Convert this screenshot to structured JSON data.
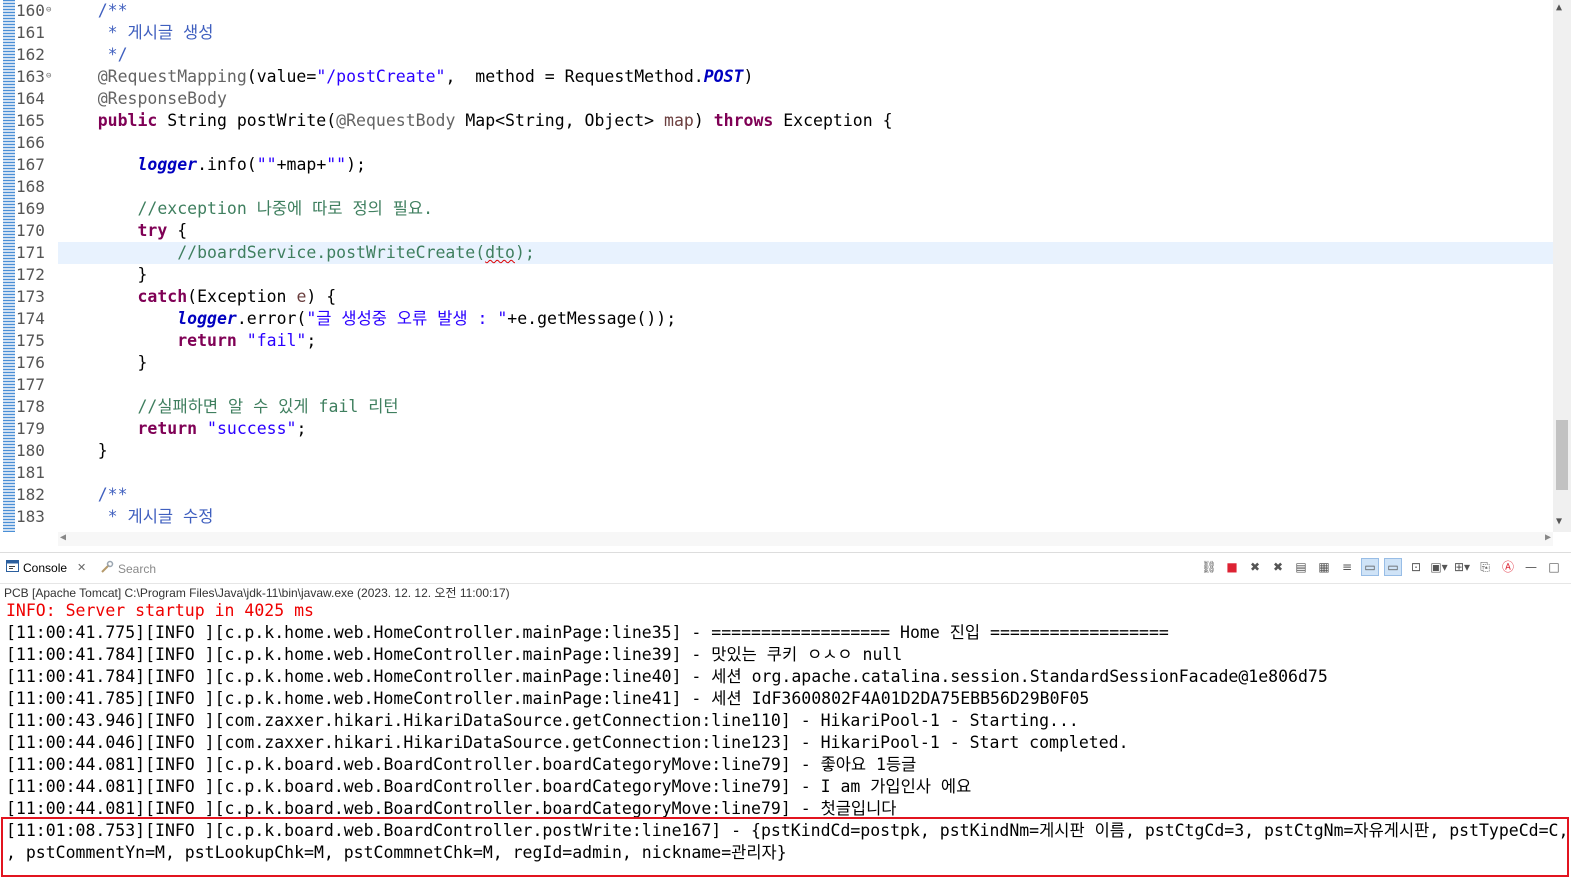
{
  "editor": {
    "line_numbers": [
      "160",
      "161",
      "162",
      "163",
      "164",
      "165",
      "166",
      "167",
      "168",
      "169",
      "170",
      "171",
      "172",
      "173",
      "174",
      "175",
      "176",
      "177",
      "178",
      "179",
      "180",
      "181",
      "182",
      "183"
    ],
    "code": {
      "l160": "/**",
      "l161": " * 게시글 생성",
      "l162": " */",
      "l163_ann": "@RequestMapping",
      "l163_a": "(value=",
      "l163_str": "\"/postCreate\"",
      "l163_b": ",  method = RequestMethod.",
      "l163_const": "POST",
      "l163_c": ")",
      "l164_ann": "@ResponseBody",
      "l165_kw1": "public",
      "l165_a": " String postWrite(",
      "l165_ann": "@RequestBody",
      "l165_b": " Map<String, Object> ",
      "l165_param": "map",
      "l165_c": ") ",
      "l165_kw2": "throws",
      "l165_d": " Exception {",
      "l167_field": "logger",
      "l167_a": ".info(",
      "l167_str1": "\"\"",
      "l167_b": "+map+",
      "l167_str2": "\"\"",
      "l167_c": ");",
      "l169_cmt": "//exception 나중에 따로 정의 필요.",
      "l170_kw": "try",
      "l170_a": " {",
      "l171_cmt_a": "//boardService.postWriteCreate(",
      "l171_cmt_sq": "dto",
      "l171_cmt_b": ");",
      "l172": "}",
      "l173_kw": "catch",
      "l173_a": "(Exception ",
      "l173_param": "e",
      "l173_b": ") {",
      "l174_field": "logger",
      "l174_a": ".error(",
      "l174_str": "\"글 생성중 오류 발생 : \"",
      "l174_b": "+e.getMessage());",
      "l175_kw": "return",
      "l175_str": "\"fail\"",
      "l175_a": ";",
      "l176": "}",
      "l178_cmt": "//실패하면 알 수 있게 fail 리턴",
      "l179_kw": "return",
      "l179_str": "\"success\"",
      "l179_a": ";",
      "l180": "}",
      "l182": "/**",
      "l183": " * 게시글 수정"
    }
  },
  "console": {
    "tab_label": "Console",
    "search_tab_label": "Search",
    "process_description": "PCB [Apache Tomcat] C:\\Program Files\\Java\\jdk-11\\bin\\javaw.exe (2023. 12. 12. 오전 11:00:17)",
    "lines": [
      "INFO: Server startup in 4025 ms",
      "[11:00:41.775][INFO ][c.p.k.home.web.HomeController.mainPage:line35] - ================== Home 진입 ==================",
      "[11:00:41.784][INFO ][c.p.k.home.web.HomeController.mainPage:line39] - 맛있는 쿠키 ㅇㅅㅇ null",
      "[11:00:41.784][INFO ][c.p.k.home.web.HomeController.mainPage:line40] - 세션 org.apache.catalina.session.StandardSessionFacade@1e806d75",
      "[11:00:41.785][INFO ][c.p.k.home.web.HomeController.mainPage:line41] - 세션 IdF3600802F4A01D2DA75EBB56D29B0F05",
      "[11:00:43.946][INFO ][com.zaxxer.hikari.HikariDataSource.getConnection:line110] - HikariPool-1 - Starting...",
      "[11:00:44.046][INFO ][com.zaxxer.hikari.HikariDataSource.getConnection:line123] - HikariPool-1 - Start completed.",
      "[11:00:44.081][INFO ][c.p.k.board.web.BoardController.boardCategoryMove:line79] - 좋아요 1등글",
      "[11:00:44.081][INFO ][c.p.k.board.web.BoardController.boardCategoryMove:line79] - I am 가입인사 에요",
      "[11:00:44.081][INFO ][c.p.k.board.web.BoardController.boardCategoryMove:line79] - 첫글입니다",
      "[11:01:08.753][INFO ][c.p.k.board.web.BoardController.postWrite:line167] - {pstKindCd=postpk, pstKindNm=게시판 이름, pstCtgCd=3, pstCtgNm=자유게시판, pstTypeCd=C,",
      ", pstCommentYn=M, pstLookupChk=M, pstCommnetChk=M, regId=admin, nickname=관리자}"
    ]
  },
  "colors": {
    "keyword": "#7f0055",
    "string": "#2a00ff",
    "comment": "#3f7f5f",
    "javadoc": "#3f5fbf",
    "annotation": "#646464",
    "field": "#0000c0",
    "error_text": "#ee0000",
    "highlight_border": "#e2141f"
  },
  "icons": [
    "console-icon",
    "search-icon",
    "link-icon",
    "terminate-icon",
    "remove-launch-icon",
    "remove-all-icon",
    "clear-console-icon",
    "scroll-lock-icon",
    "word-wrap-icon",
    "show-on-stdout-icon",
    "show-on-stderr-icon",
    "pin-console-icon",
    "display-selected-icon",
    "open-console-icon",
    "new-console-view-icon",
    "minimize-icon",
    "maximize-icon"
  ]
}
